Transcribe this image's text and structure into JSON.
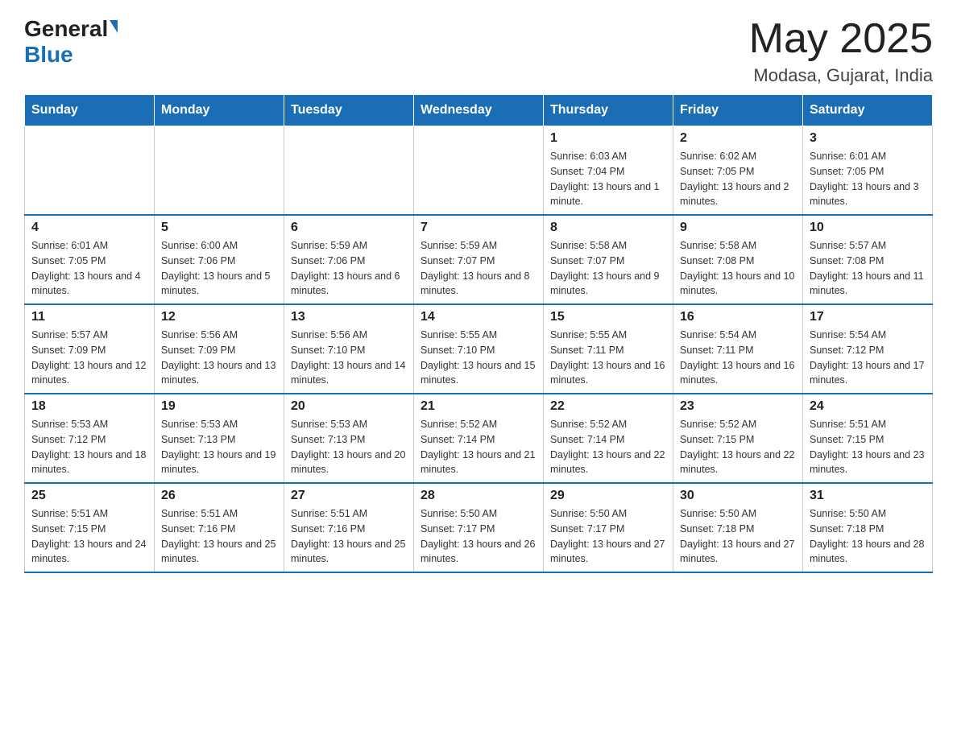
{
  "header": {
    "logo_general": "General",
    "logo_blue": "Blue",
    "month_title": "May 2025",
    "location": "Modasa, Gujarat, India"
  },
  "weekdays": [
    "Sunday",
    "Monday",
    "Tuesday",
    "Wednesday",
    "Thursday",
    "Friday",
    "Saturday"
  ],
  "weeks": [
    [
      {
        "day": "",
        "info": ""
      },
      {
        "day": "",
        "info": ""
      },
      {
        "day": "",
        "info": ""
      },
      {
        "day": "",
        "info": ""
      },
      {
        "day": "1",
        "info": "Sunrise: 6:03 AM\nSunset: 7:04 PM\nDaylight: 13 hours and 1 minute."
      },
      {
        "day": "2",
        "info": "Sunrise: 6:02 AM\nSunset: 7:05 PM\nDaylight: 13 hours and 2 minutes."
      },
      {
        "day": "3",
        "info": "Sunrise: 6:01 AM\nSunset: 7:05 PM\nDaylight: 13 hours and 3 minutes."
      }
    ],
    [
      {
        "day": "4",
        "info": "Sunrise: 6:01 AM\nSunset: 7:05 PM\nDaylight: 13 hours and 4 minutes."
      },
      {
        "day": "5",
        "info": "Sunrise: 6:00 AM\nSunset: 7:06 PM\nDaylight: 13 hours and 5 minutes."
      },
      {
        "day": "6",
        "info": "Sunrise: 5:59 AM\nSunset: 7:06 PM\nDaylight: 13 hours and 6 minutes."
      },
      {
        "day": "7",
        "info": "Sunrise: 5:59 AM\nSunset: 7:07 PM\nDaylight: 13 hours and 8 minutes."
      },
      {
        "day": "8",
        "info": "Sunrise: 5:58 AM\nSunset: 7:07 PM\nDaylight: 13 hours and 9 minutes."
      },
      {
        "day": "9",
        "info": "Sunrise: 5:58 AM\nSunset: 7:08 PM\nDaylight: 13 hours and 10 minutes."
      },
      {
        "day": "10",
        "info": "Sunrise: 5:57 AM\nSunset: 7:08 PM\nDaylight: 13 hours and 11 minutes."
      }
    ],
    [
      {
        "day": "11",
        "info": "Sunrise: 5:57 AM\nSunset: 7:09 PM\nDaylight: 13 hours and 12 minutes."
      },
      {
        "day": "12",
        "info": "Sunrise: 5:56 AM\nSunset: 7:09 PM\nDaylight: 13 hours and 13 minutes."
      },
      {
        "day": "13",
        "info": "Sunrise: 5:56 AM\nSunset: 7:10 PM\nDaylight: 13 hours and 14 minutes."
      },
      {
        "day": "14",
        "info": "Sunrise: 5:55 AM\nSunset: 7:10 PM\nDaylight: 13 hours and 15 minutes."
      },
      {
        "day": "15",
        "info": "Sunrise: 5:55 AM\nSunset: 7:11 PM\nDaylight: 13 hours and 16 minutes."
      },
      {
        "day": "16",
        "info": "Sunrise: 5:54 AM\nSunset: 7:11 PM\nDaylight: 13 hours and 16 minutes."
      },
      {
        "day": "17",
        "info": "Sunrise: 5:54 AM\nSunset: 7:12 PM\nDaylight: 13 hours and 17 minutes."
      }
    ],
    [
      {
        "day": "18",
        "info": "Sunrise: 5:53 AM\nSunset: 7:12 PM\nDaylight: 13 hours and 18 minutes."
      },
      {
        "day": "19",
        "info": "Sunrise: 5:53 AM\nSunset: 7:13 PM\nDaylight: 13 hours and 19 minutes."
      },
      {
        "day": "20",
        "info": "Sunrise: 5:53 AM\nSunset: 7:13 PM\nDaylight: 13 hours and 20 minutes."
      },
      {
        "day": "21",
        "info": "Sunrise: 5:52 AM\nSunset: 7:14 PM\nDaylight: 13 hours and 21 minutes."
      },
      {
        "day": "22",
        "info": "Sunrise: 5:52 AM\nSunset: 7:14 PM\nDaylight: 13 hours and 22 minutes."
      },
      {
        "day": "23",
        "info": "Sunrise: 5:52 AM\nSunset: 7:15 PM\nDaylight: 13 hours and 22 minutes."
      },
      {
        "day": "24",
        "info": "Sunrise: 5:51 AM\nSunset: 7:15 PM\nDaylight: 13 hours and 23 minutes."
      }
    ],
    [
      {
        "day": "25",
        "info": "Sunrise: 5:51 AM\nSunset: 7:15 PM\nDaylight: 13 hours and 24 minutes."
      },
      {
        "day": "26",
        "info": "Sunrise: 5:51 AM\nSunset: 7:16 PM\nDaylight: 13 hours and 25 minutes."
      },
      {
        "day": "27",
        "info": "Sunrise: 5:51 AM\nSunset: 7:16 PM\nDaylight: 13 hours and 25 minutes."
      },
      {
        "day": "28",
        "info": "Sunrise: 5:50 AM\nSunset: 7:17 PM\nDaylight: 13 hours and 26 minutes."
      },
      {
        "day": "29",
        "info": "Sunrise: 5:50 AM\nSunset: 7:17 PM\nDaylight: 13 hours and 27 minutes."
      },
      {
        "day": "30",
        "info": "Sunrise: 5:50 AM\nSunset: 7:18 PM\nDaylight: 13 hours and 27 minutes."
      },
      {
        "day": "31",
        "info": "Sunrise: 5:50 AM\nSunset: 7:18 PM\nDaylight: 13 hours and 28 minutes."
      }
    ]
  ]
}
